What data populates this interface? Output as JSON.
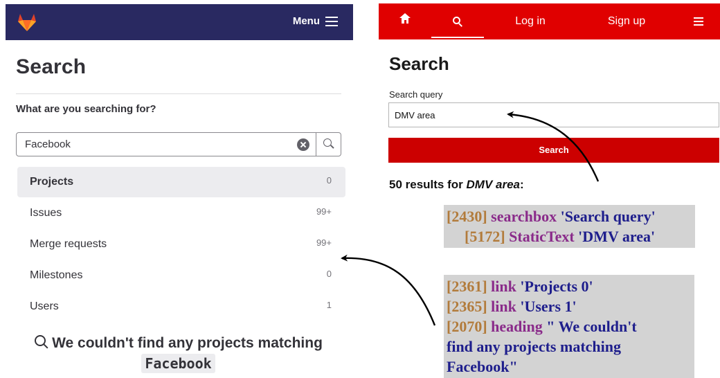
{
  "left": {
    "menu_label": "Menu",
    "title": "Search",
    "subtitle": "What are you searching for?",
    "search_value": "Facebook",
    "scopes": [
      {
        "label": "Projects",
        "count": "0"
      },
      {
        "label": "Issues",
        "count": "99+"
      },
      {
        "label": "Merge requests",
        "count": "99+"
      },
      {
        "label": "Milestones",
        "count": "0"
      },
      {
        "label": "Users",
        "count": "1"
      }
    ],
    "empty_text": "We couldn't find any projects matching",
    "empty_term": "Facebook"
  },
  "right": {
    "nav": {
      "login": "Log in",
      "signup": "Sign up"
    },
    "title": "Search",
    "query_label": "Search query",
    "query_value": "DMV area",
    "search_button": "Search",
    "results_prefix": "50 results for ",
    "results_term": "DMV area",
    "results_suffix": ":"
  },
  "annotations": {
    "box1": [
      {
        "id": "[2430]",
        "role": "searchbox",
        "name": "'Search query'"
      },
      {
        "id": "[5172]",
        "role": "StaticText",
        "name": "'DMV area'"
      }
    ],
    "box2": [
      {
        "id": "[2361]",
        "role": "link",
        "name": "'Projects 0'"
      },
      {
        "id": "[2365]",
        "role": "link",
        "name": "'Users 1'"
      },
      {
        "id": "[2070]",
        "role": "heading",
        "name": "\" We couldn't"
      },
      {
        "name": "find any projects matching"
      },
      {
        "name": "Facebook\""
      }
    ]
  },
  "colors": {
    "gitlab_nav": "#292961",
    "wiki_nav": "#e00000",
    "wiki_button": "#cc0000",
    "annotation_bg": "#d3d3d3",
    "annotation_id": "#b27b3b",
    "annotation_role": "#8a2b8a",
    "annotation_name": "#1e1e8c"
  },
  "icons": [
    "gitlab-logo",
    "hamburger-icon",
    "clear-icon",
    "search-icon",
    "home-icon"
  ]
}
